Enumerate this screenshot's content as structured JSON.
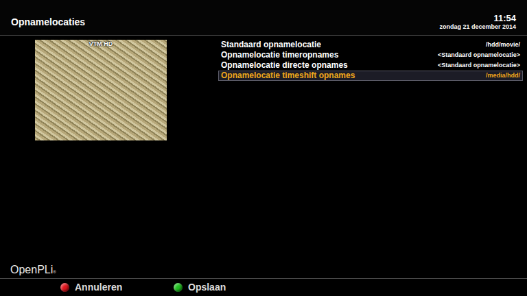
{
  "window": {
    "title": "Opnamelocaties"
  },
  "clock": {
    "time": "11:54",
    "date": "zondag 21 december 2014"
  },
  "preview": {
    "channel": "VTM HD"
  },
  "settings": [
    {
      "label": "Standaard opnamelocatie",
      "value": "/hdd/movie/",
      "selected": false
    },
    {
      "label": "Opnamelocatie timeropnames",
      "value": "<Standaard opnamelocatie>",
      "selected": false
    },
    {
      "label": "Opnamelocatie directe opnames",
      "value": "<Standaard opnamelocatie>",
      "selected": false
    },
    {
      "label": "Opnamelocatie timeshift opnames",
      "value": "/media/hdd/",
      "selected": true
    }
  ],
  "logo": {
    "text": "OpenPLi",
    "mark": "®"
  },
  "buttons": [
    {
      "label": "Annuleren",
      "color": "#e0141c"
    },
    {
      "label": "Opslaan",
      "color": "#1fc01f"
    }
  ]
}
